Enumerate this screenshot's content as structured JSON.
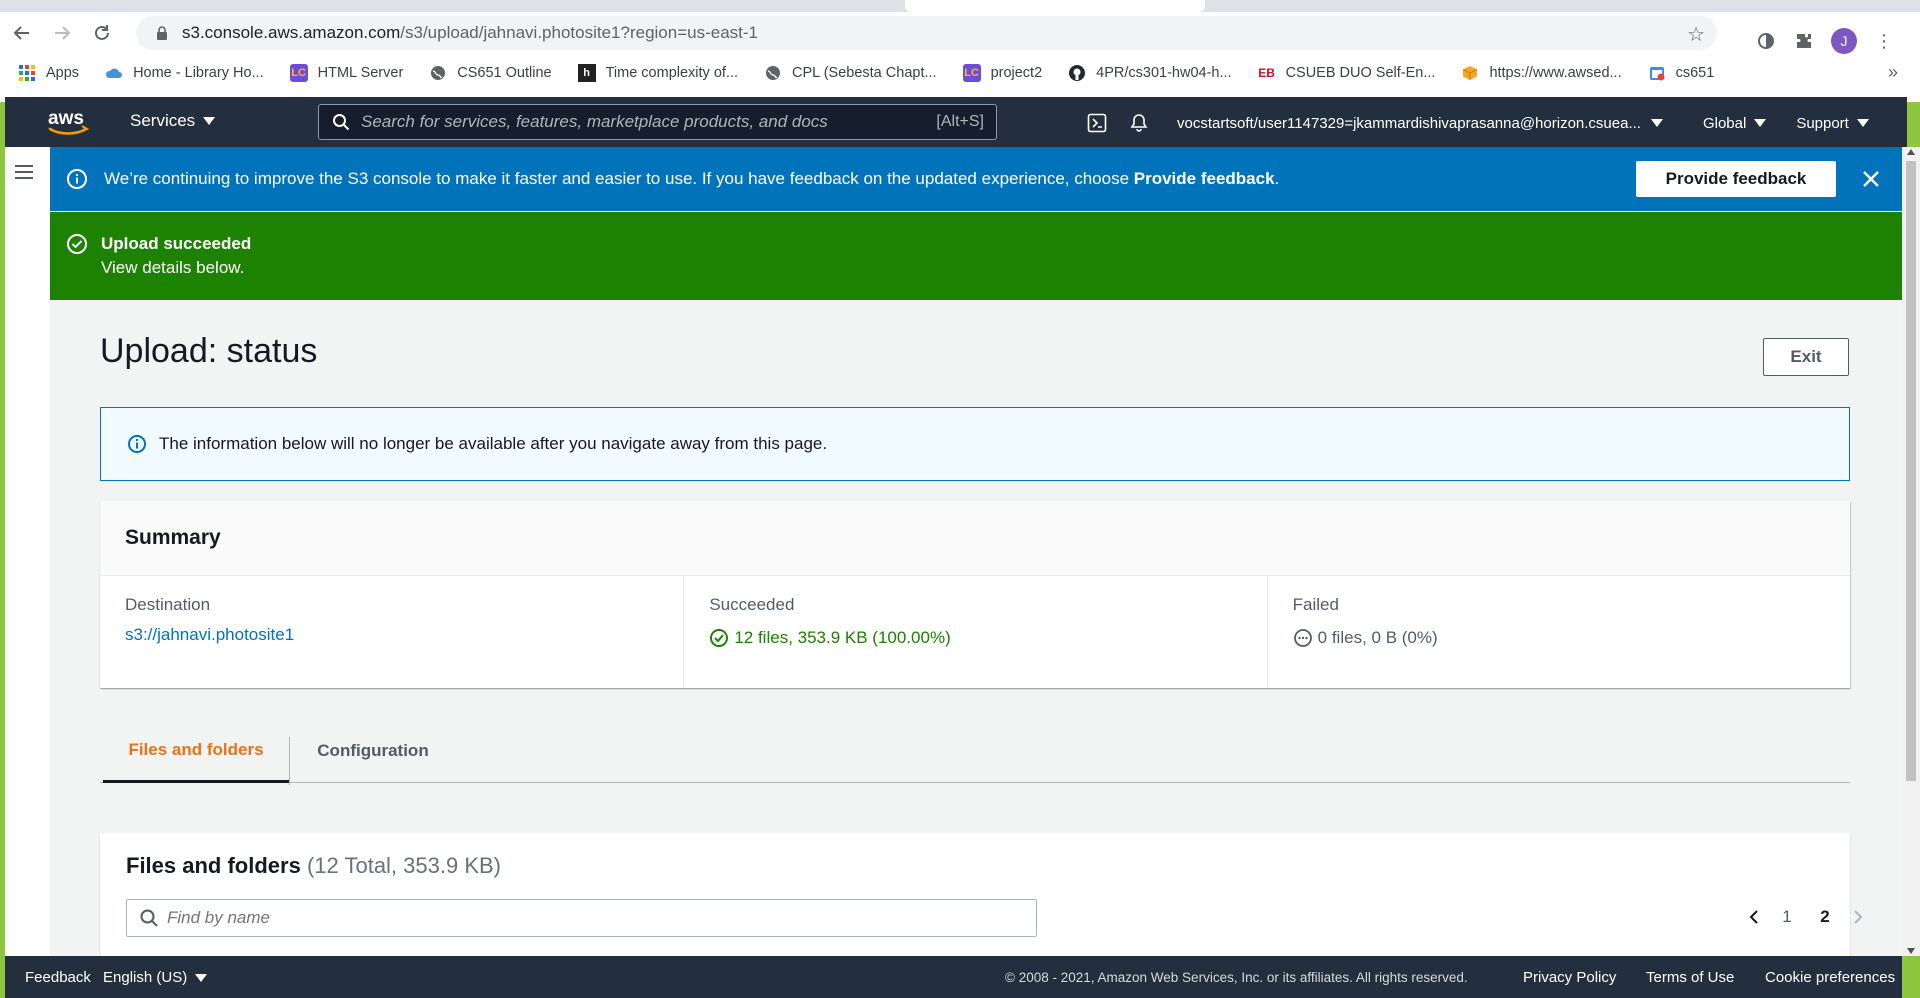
{
  "browser": {
    "url_host": "s3.console.aws.amazon.com",
    "url_path": "/s3/upload/jahnavi.photosite1?region=us-east-1",
    "profile_initial": "J",
    "bookmarks": [
      {
        "label": "Apps",
        "icon": "apps-grid-icon"
      },
      {
        "label": "Home - Library Ho...",
        "icon": "cloud-icon"
      },
      {
        "label": "HTML Server",
        "icon": "leetcode-icon"
      },
      {
        "label": "CS651 Outline",
        "icon": "globe-icon"
      },
      {
        "label": "Time complexity of...",
        "icon": "h-icon"
      },
      {
        "label": "CPL (Sebesta Chapt...",
        "icon": "globe-icon"
      },
      {
        "label": "project2",
        "icon": "leetcode-icon"
      },
      {
        "label": "4PR/cs301-hw04-h...",
        "icon": "github-icon"
      },
      {
        "label": "CSUEB DUO Self-En...",
        "icon": "eb-icon"
      },
      {
        "label": "https://www.awsed...",
        "icon": "box-icon"
      },
      {
        "label": "cs651",
        "icon": "calendar-icon"
      }
    ],
    "bookmarks_more": "»"
  },
  "aws_nav": {
    "services_label": "Services",
    "search_placeholder": "Search for services, features, marketplace products, and docs",
    "search_shortcut": "[Alt+S]",
    "account": "vocstartsoft/user1147329=jkammardishivaprasanna@horizon.csuea...",
    "region": "Global",
    "support": "Support"
  },
  "info_banner": {
    "text": "We’re continuing to improve the S3 console to make it faster and easier to use. If you have feedback on the updated experience, choose ",
    "bold": "Provide feedback",
    "text_end": ".",
    "button": "Provide feedback"
  },
  "success_banner": {
    "title": "Upload succeeded",
    "subtitle": "View details below."
  },
  "page": {
    "title": "Upload: status",
    "exit_button": "Exit",
    "notice": "The information below will no longer be available after you navigate away from this page."
  },
  "summary": {
    "heading": "Summary",
    "destination_label": "Destination",
    "destination_value": "s3://jahnavi.photosite1",
    "succeeded_label": "Succeeded",
    "succeeded_value": "12 files, 353.9 KB (100.00%)",
    "failed_label": "Failed",
    "failed_value": "0 files, 0 B (0%)"
  },
  "tabs": [
    {
      "label": "Files and folders",
      "active": true
    },
    {
      "label": "Configuration",
      "active": false
    }
  ],
  "files": {
    "heading": "Files and folders",
    "count": "(12 Total, 353.9 KB)",
    "find_placeholder": "Find by name",
    "pages": [
      "1",
      "2"
    ],
    "current_page": "2"
  },
  "footer": {
    "feedback": "Feedback",
    "language": "English (US)",
    "copyright": "© 2008 - 2021, Amazon Web Services, Inc. or its affiliates. All rights reserved.",
    "privacy": "Privacy Policy",
    "terms": "Terms of Use",
    "cookies": "Cookie preferences"
  },
  "colors": {
    "aws_nav_bg": "#232f3e",
    "info_blue": "#0073bb",
    "success_green": "#1d8102",
    "tab_active_orange": "#ec7211"
  }
}
